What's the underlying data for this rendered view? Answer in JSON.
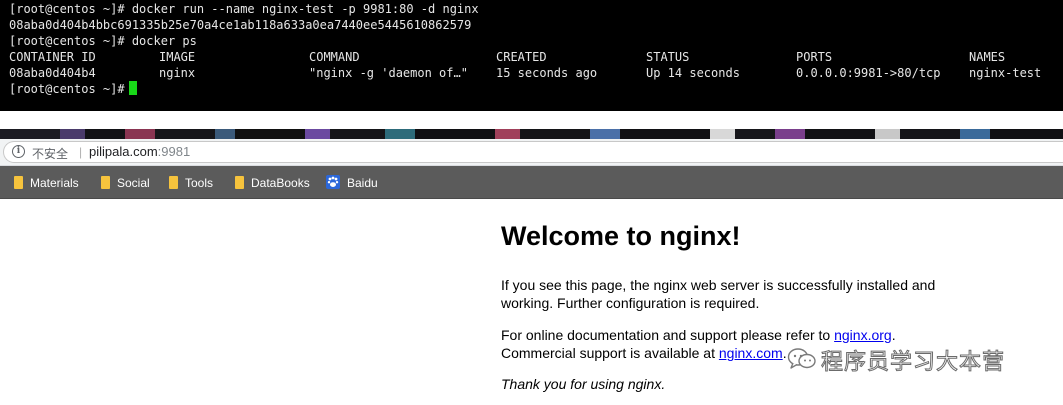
{
  "terminal": {
    "line1": "[root@centos ~]# docker run --name nginx-test -p 9981:80 -d nginx",
    "line2": "08aba0d404b4bbc691335b25e70a4ce1ab118a633a0ea7440ee5445610862579",
    "line3": "[root@centos ~]# docker ps",
    "ps_headers": {
      "container_id": "CONTAINER ID",
      "image": "IMAGE",
      "command": "COMMAND",
      "created": "CREATED",
      "status": "STATUS",
      "ports": "PORTS",
      "names": "NAMES"
    },
    "ps_row": {
      "container_id": "08aba0d404b4",
      "image": "nginx",
      "command": "\"nginx -g 'daemon of…\"",
      "created": "15 seconds ago",
      "status": "Up 14 seconds",
      "ports": "0.0.0.0:9981->80/tcp",
      "names": "nginx-test"
    },
    "prompt": "[root@centos ~]#",
    "cursor_color": "#18d818"
  },
  "browser": {
    "address": {
      "info_icon": "info-icon",
      "security_label": "不安全",
      "separator": "|",
      "host": "pilipala.com",
      "port": ":9981"
    },
    "bookmarks": [
      {
        "label": "Materials",
        "icon": "folder-icon"
      },
      {
        "label": "Social",
        "icon": "folder-icon"
      },
      {
        "label": "Tools",
        "icon": "folder-icon"
      },
      {
        "label": "DataBooks",
        "icon": "folder-icon"
      },
      {
        "label": "Baidu",
        "icon": "baidu-paw-icon"
      }
    ]
  },
  "page": {
    "title": "Welcome to nginx!",
    "p1": "If you see this page, the nginx web server is successfully installed and working. Further configuration is required.",
    "p2_prefix": "For online documentation and support please refer to ",
    "p2_link": "nginx.org",
    "p2_suffix": ".",
    "p2b_prefix": "Commercial support is available at ",
    "p2b_link": "nginx.com",
    "p2b_suffix": ".",
    "p3": "Thank you for using nginx."
  },
  "watermark": {
    "icon": "wechat-icon",
    "text": "程序员学习大本营"
  }
}
